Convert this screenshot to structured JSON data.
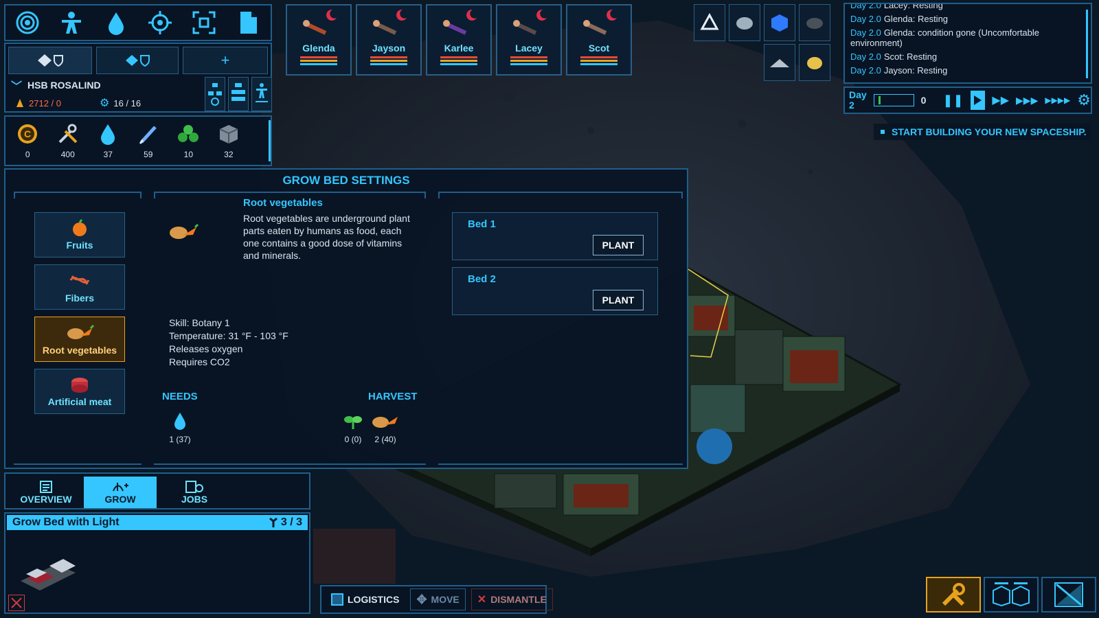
{
  "toolbar": {
    "tools": [
      "target-icon",
      "crew-icon",
      "water-icon",
      "crosshair-icon",
      "focus-icon",
      "document-icon"
    ]
  },
  "ship": {
    "add_tab_label": "+",
    "name": "HSB ROSALIND",
    "fuel": "2712 / 0",
    "crew_capacity": "16 / 16"
  },
  "resources": [
    {
      "icon": "credits-icon",
      "value": "0"
    },
    {
      "icon": "tools-icon",
      "value": "400"
    },
    {
      "icon": "water-drop-icon",
      "value": "37"
    },
    {
      "icon": "pen-icon",
      "value": "59"
    },
    {
      "icon": "food-icon",
      "value": "10"
    },
    {
      "icon": "crate-icon",
      "value": "32"
    }
  ],
  "crew": [
    {
      "name": "Glenda"
    },
    {
      "name": "Jayson"
    },
    {
      "name": "Karlee"
    },
    {
      "name": "Lacey"
    },
    {
      "name": "Scot"
    }
  ],
  "log": [
    {
      "day": "Day 2.0",
      "text": "Lacey: Resting"
    },
    {
      "day": "Day 2.0",
      "text": "Glenda: Resting"
    },
    {
      "day": "Day 2.0",
      "text": "Glenda: condition gone (Uncomfortable environment)"
    },
    {
      "day": "Day 2.0",
      "text": "Scot: Resting"
    },
    {
      "day": "Day 2.0",
      "text": "Jayson: Resting"
    }
  ],
  "speed": {
    "day_label": "Day",
    "day_number": "2",
    "counter": "0"
  },
  "objective": "START BUILDING YOUR NEW SPACESHIP.",
  "grow_settings": {
    "title": "GROW BED SETTINGS",
    "categories": [
      "Fruits",
      "Fibers",
      "Root vegetables",
      "Artificial meat"
    ],
    "selected": {
      "name": "Root vegetables",
      "description": "Root vegetables are underground plant parts eaten by humans as food, each one contains a good dose of vitamins and minerals.",
      "skill": "Skill: Botany 1",
      "temperature": "Temperature: 31 °F  -  103 °F",
      "releases": "Releases oxygen",
      "requires": "Requires CO2",
      "needs_label": "NEEDS",
      "needs_value": "1 (37)",
      "harvest_label": "HARVEST",
      "harvest_seed": "0 (0)",
      "harvest_food": "2 (40)"
    },
    "beds": [
      {
        "label": "Bed 1",
        "button": "PLANT"
      },
      {
        "label": "Bed 2",
        "button": "PLANT"
      }
    ]
  },
  "object_panel": {
    "tabs": [
      "OVERVIEW",
      "GROW",
      "JOBS"
    ],
    "title": "Grow Bed with Light",
    "count": "3 / 3"
  },
  "actions": {
    "logistics": "LOGISTICS",
    "move": "MOVE",
    "dismantle": "DISMANTLE"
  },
  "colors": {
    "accent": "#35c6ff",
    "selected": "#e8a21e",
    "danger": "#d23a3a"
  }
}
